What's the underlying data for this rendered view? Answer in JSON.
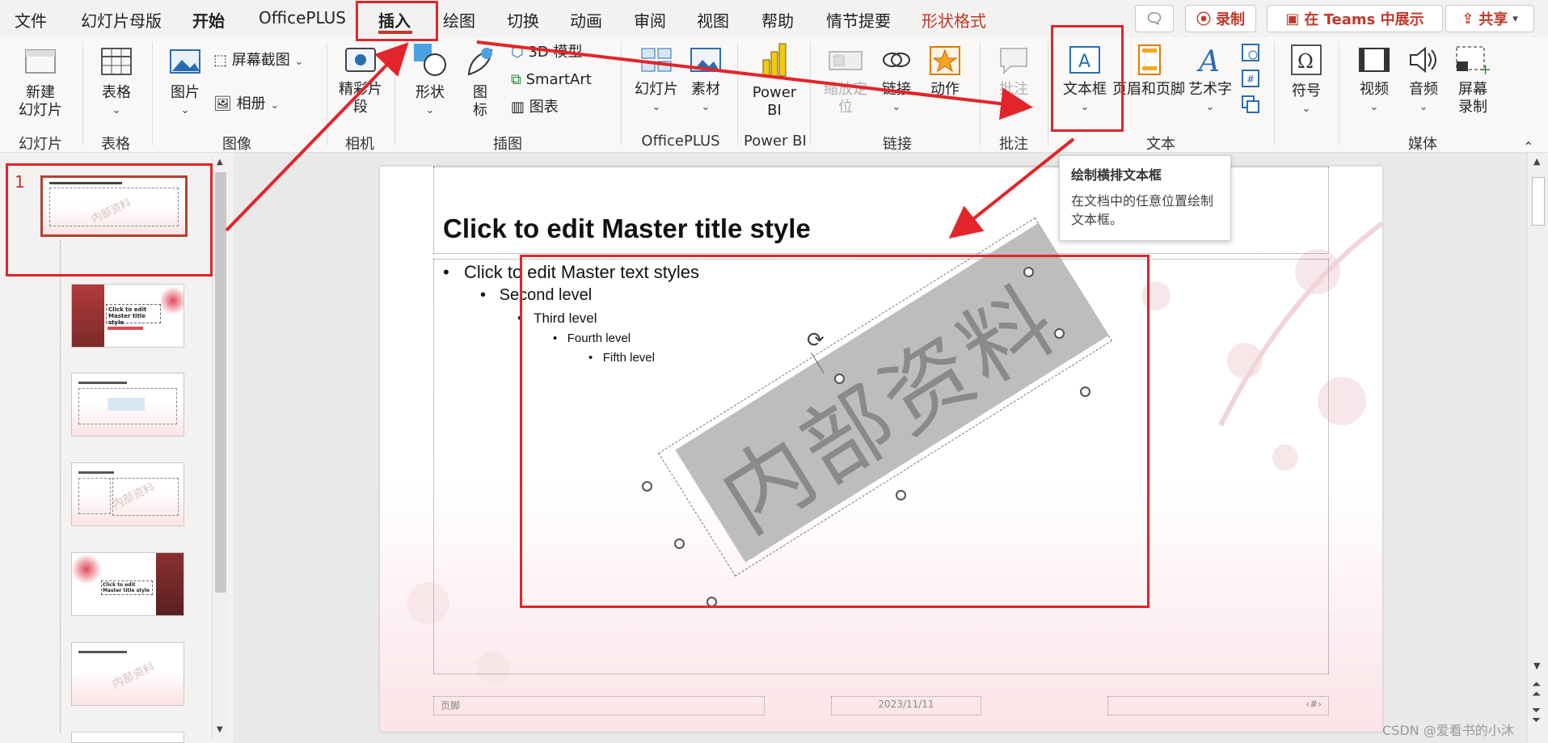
{
  "tabs": [
    {
      "label": "文件"
    },
    {
      "label": "幻灯片母版"
    },
    {
      "label": "开始"
    },
    {
      "label": "OfficePLUS"
    },
    {
      "label": "插入"
    },
    {
      "label": "绘图"
    },
    {
      "label": "切换"
    },
    {
      "label": "动画"
    },
    {
      "label": "审阅"
    },
    {
      "label": "视图"
    },
    {
      "label": "帮助"
    },
    {
      "label": "情节提要"
    },
    {
      "label": "形状格式"
    }
  ],
  "top_buttons": {
    "record": "录制",
    "teams": "在 Teams 中展示",
    "share": "共享"
  },
  "ribbon": {
    "new_slide": "新建\n幻灯片",
    "table": "表格",
    "picture": "图片",
    "screenshot": "屏幕截图",
    "album": "相册",
    "camera_clip": "精彩片\n段",
    "shapes": "形状",
    "icons": "图\n标",
    "model3d": "3D 模型",
    "smartart": "SmartArt",
    "chart": "图表",
    "slides_plus": "幻灯片",
    "materials": "素材",
    "powerbi": "Power\nBI",
    "zoom": "缩放定\n位",
    "link": "链接",
    "action": "动作",
    "comment": "批注",
    "textbox": "文本框",
    "header_footer": "页眉和页脚",
    "wordart": "艺术字",
    "symbol": "符号",
    "video": "视频",
    "audio": "音频",
    "screen_record": "屏幕\n录制",
    "groups": {
      "slides": "幻灯片",
      "tables": "表格",
      "images": "图像",
      "camera": "相机",
      "illustrations": "插图",
      "officeplus": "OfficePLUS",
      "powerbi": "Power BI",
      "links": "链接",
      "comments": "批注",
      "text": "文本",
      "media": "媒体"
    }
  },
  "thumbs": {
    "first_number": "1",
    "wm": "内部资料",
    "t2_line1": "Click to edit",
    "t2_line2": "Master title style",
    "t5_text": "Click to edit Master title style"
  },
  "slide": {
    "title": "Click to edit Master title style",
    "levels": [
      "Click to edit Master text styles",
      "Second level",
      "Third level",
      "Fourth level",
      "Fifth level"
    ],
    "watermark": "内部资料",
    "footer_left": "页脚",
    "footer_date": "2023/11/11",
    "footer_right": "‹#›"
  },
  "tooltip": {
    "title": "绘制横排文本框",
    "body": "在文档中的任意位置绘制文本框。"
  },
  "watermark_credit": "CSDN @爱看书的小沐",
  "colors": {
    "accent_red": "#e3242b",
    "tab_active": "#c0392b"
  }
}
